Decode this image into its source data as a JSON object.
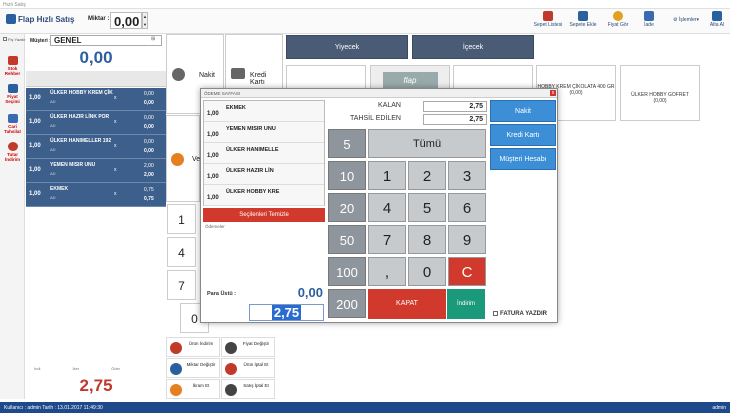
{
  "window": {
    "title": "Hızlı Satış"
  },
  "app": {
    "title": "Flap Hızlı Satış"
  },
  "miktar": {
    "label": "Miktar :",
    "value": "0,00"
  },
  "toolbar": [
    {
      "label": "Sepet Listesi"
    },
    {
      "label": "Sepete Ekle"
    },
    {
      "label": "Fiyat Gör"
    },
    {
      "label": "İade"
    },
    {
      "label": "İşlemler"
    },
    {
      "label": "Alta Al"
    }
  ],
  "sidebar": {
    "fis_yazdir": "Fiş Yazdır",
    "items": [
      {
        "label": "Stok Rehber"
      },
      {
        "label": "Fiyat Seçimi"
      },
      {
        "label": "Cari Tahsilat"
      },
      {
        "label": "Tutar İndirim"
      }
    ]
  },
  "customer": {
    "label": "Müşteri :",
    "value": "GENEL"
  },
  "cart": {
    "top_total": "0,00",
    "items": [
      {
        "qty": "1,00",
        "name": "ÜLKER HOBBY KREM ÇİK",
        "sub": "AD",
        "x": "x",
        "unit": "0,00",
        "total": "0,00"
      },
      {
        "qty": "1,00",
        "name": "ÜLKER HAZIR LİNK POR",
        "sub": "AD",
        "x": "x",
        "unit": "0,00",
        "total": "0,00"
      },
      {
        "qty": "1,00",
        "name": "ÜLKER HANIMELLER 192",
        "sub": "AD",
        "x": "x",
        "unit": "0,00",
        "total": "0,00"
      },
      {
        "qty": "1,00",
        "name": "YEMEN MISIR UNU",
        "sub": "AD",
        "x": "x",
        "unit": "2,00",
        "total": "2,00"
      },
      {
        "qty": "1,00",
        "name": "EKMEK",
        "sub": "AD",
        "x": "x",
        "unit": "0,75",
        "total": "0,75"
      }
    ],
    "stats": {
      "indirim": "İndi",
      "iker": "İker",
      "oder": "Öder"
    },
    "bottom_total": "2,75"
  },
  "payment_buttons": {
    "nakit": "Nakit",
    "kredi": "Kredi Kartı",
    "veresiye": "Ve"
  },
  "left_numpad": [
    "1",
    "4",
    "7",
    "0"
  ],
  "actions": [
    {
      "label": "Ürün İndirim"
    },
    {
      "label": "Fiyat Değiştir"
    },
    {
      "label": "Miktar Değiştir"
    },
    {
      "label": "Ürün İptal Et"
    },
    {
      "label": "İkram Et"
    },
    {
      "label": "Satış İptal Et"
    }
  ],
  "categories": [
    {
      "label": "Yiyecek"
    },
    {
      "label": "İçecek"
    }
  ],
  "products": [
    {
      "name": "",
      "price": ""
    },
    {
      "name": "flap",
      "price": ""
    },
    {
      "name": "",
      "price": ""
    },
    {
      "name": "",
      "price": ""
    },
    {
      "name": "HOBBY KREM ÇİKOLATA 400 GR",
      "price": "(0,00)"
    },
    {
      "name": "ÜLKER HOBBY GOFRET",
      "price": "(0,00)"
    }
  ],
  "dialog": {
    "title": "ÖDEME SAYFASI",
    "close": "x",
    "items": [
      {
        "qty": "1,00",
        "name": "EKMEK"
      },
      {
        "qty": "1,00",
        "name": "YEMEN MISIR UNU"
      },
      {
        "qty": "1,00",
        "name": "ÜLKER HANIMELLE"
      },
      {
        "qty": "1,00",
        "name": "ÜLKER HAZIR LİN"
      },
      {
        "qty": "1,00",
        "name": "ÜLKER HOBBY KRE"
      }
    ],
    "clear_button": "Seçilenleri Temizle",
    "odemeler_label": "Ödemeler",
    "paraustu_label": "Para Üstü :",
    "paraustu_value": "0,00",
    "input_value": "2,75",
    "kalan_label": "KALAN",
    "kalan_value": "2,75",
    "tahsil_label": "TAHSİL EDİLEN",
    "tahsil_value": "2,75",
    "denominations": [
      "5",
      "10",
      "20",
      "50",
      "100",
      "200"
    ],
    "tumu": "Tümü",
    "keys": [
      "1",
      "2",
      "3",
      "4",
      "5",
      "6",
      "7",
      "8",
      "9",
      ",",
      "0",
      "C"
    ],
    "kapat": "KAPAT",
    "indirim": "İndirim",
    "methods": [
      "Nakit",
      "Kredi Kartı",
      "Müşteri Hesabı"
    ],
    "fatura": "FATURA YAZDIR"
  },
  "status": {
    "text": "Kullanıcı : admin Tarih : 13.01.2017 11:49:30",
    "user": "admin"
  }
}
